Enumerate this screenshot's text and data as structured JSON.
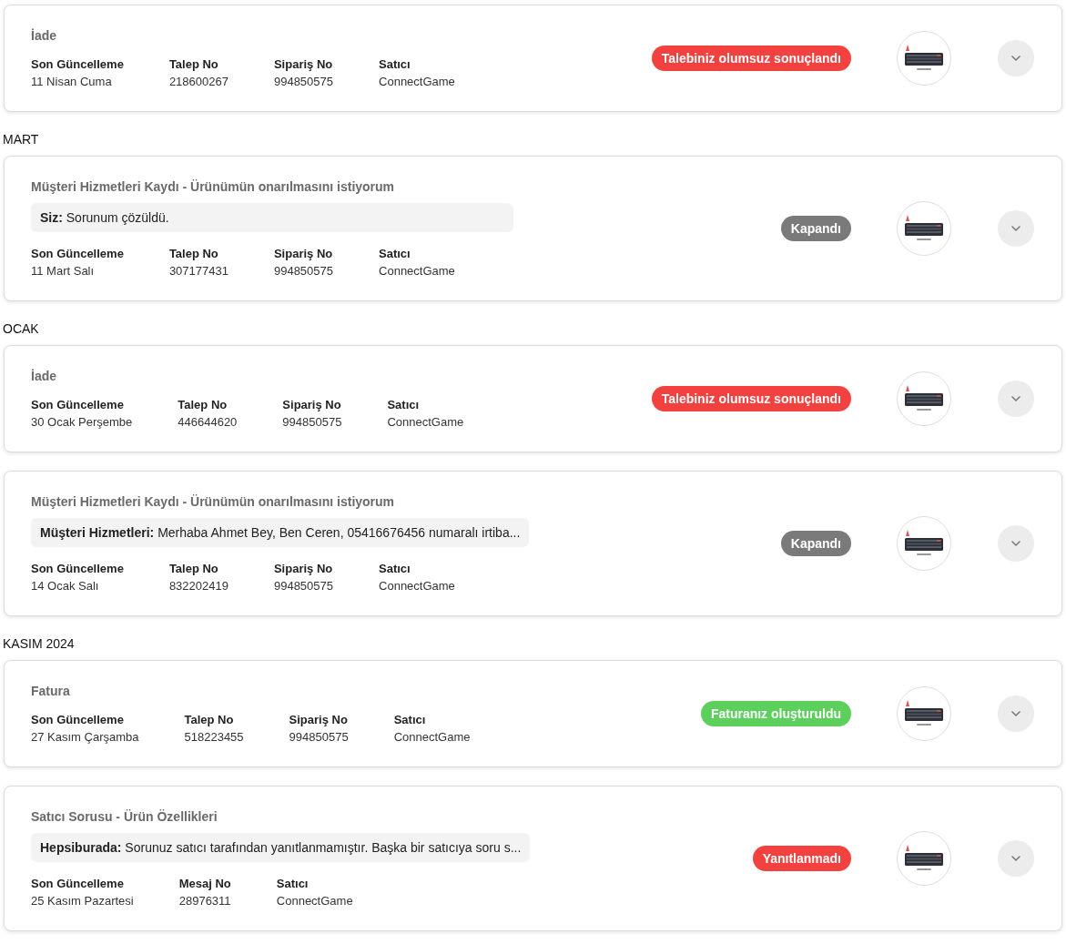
{
  "groups": [
    {
      "cards": [
        {
          "title": "İade",
          "fields": [
            {
              "label": "Son Güncelleme",
              "value": "11 Nisan Cuma"
            },
            {
              "label": "Talep No",
              "value": "218600267"
            },
            {
              "label": "Sipariş No",
              "value": "994850575"
            },
            {
              "label": "Satıcı",
              "value": "ConnectGame"
            }
          ],
          "status": {
            "text": "Talebiniz olumsuz sonuçlandı",
            "color": "#f2413f"
          }
        }
      ]
    },
    {
      "heading": "MART",
      "cards": [
        {
          "title": "Müşteri Hizmetleri Kaydı - Ürünümün onarılmasını istiyorum",
          "message": "**Siz:** Sorunum çözüldü.",
          "fields": [
            {
              "label": "Son Güncelleme",
              "value": "11 Mart Salı"
            },
            {
              "label": "Talep No",
              "value": "307177431"
            },
            {
              "label": "Sipariş No",
              "value": "994850575"
            },
            {
              "label": "Satıcı",
              "value": "ConnectGame"
            }
          ],
          "status": {
            "text": "Kapandı",
            "color": "#7a7a7a"
          }
        }
      ]
    },
    {
      "heading": "OCAK",
      "cards": [
        {
          "title": "İade",
          "fields": [
            {
              "label": "Son Güncelleme",
              "value": "30 Ocak Perşembe"
            },
            {
              "label": "Talep No",
              "value": "446644620"
            },
            {
              "label": "Sipariş No",
              "value": "994850575"
            },
            {
              "label": "Satıcı",
              "value": "ConnectGame"
            }
          ],
          "status": {
            "text": "Talebiniz olumsuz sonuçlandı",
            "color": "#f2413f"
          }
        },
        {
          "title": "Müşteri Hizmetleri Kaydı - Ürünümün onarılmasını istiyorum",
          "message": "**Müşteri Hizmetleri:** Merhaba Ahmet Bey, Ben Ceren, 05416676456 numaralı irtiba...",
          "fields": [
            {
              "label": "Son Güncelleme",
              "value": "14 Ocak Salı"
            },
            {
              "label": "Talep No",
              "value": "832202419"
            },
            {
              "label": "Sipariş No",
              "value": "994850575"
            },
            {
              "label": "Satıcı",
              "value": "ConnectGame"
            }
          ],
          "status": {
            "text": "Kapandı",
            "color": "#7a7a7a"
          }
        }
      ]
    },
    {
      "heading": "KASIM 2024",
      "cards": [
        {
          "title": "Fatura",
          "fields": [
            {
              "label": "Son Güncelleme",
              "value": "27 Kasım Çarşamba"
            },
            {
              "label": "Talep No",
              "value": "518223455"
            },
            {
              "label": "Sipariş No",
              "value": "994850575"
            },
            {
              "label": "Satıcı",
              "value": "ConnectGame"
            }
          ],
          "status": {
            "text": "Faturanız oluşturuldu",
            "color": "#5dcf5d"
          }
        },
        {
          "title": "Satıcı Sorusu - Ürün Özellikleri",
          "message": "**Hepsiburada:** Sorunuz satıcı tarafından yanıtlanmamıştır. Başka bir satıcıya soru s...",
          "fields": [
            {
              "label": "Son Güncelleme",
              "value": "25 Kasım Pazartesi"
            },
            {
              "label": "Mesaj No",
              "value": "28976311"
            },
            {
              "label": "Satıcı",
              "value": "ConnectGame"
            }
          ],
          "status": {
            "text": "Yanıtlanmadı",
            "color": "#f2413f"
          }
        }
      ]
    }
  ]
}
